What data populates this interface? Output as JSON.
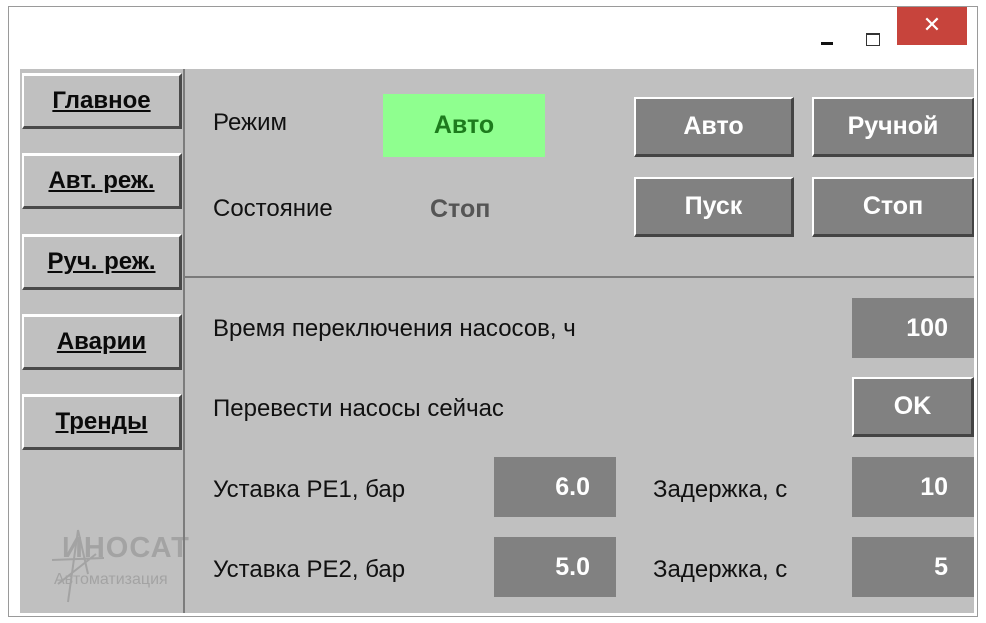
{
  "titlebar": {
    "minimize_icon": "minimize-icon",
    "maximize_icon": "maximize-icon",
    "close_glyph": "✕",
    "close_color": "#c7443c"
  },
  "nav": {
    "items": [
      {
        "label": "Главное"
      },
      {
        "label": "Авт. реж."
      },
      {
        "label": "Руч. реж."
      },
      {
        "label": "Аварии"
      },
      {
        "label": "Тренды"
      }
    ]
  },
  "logo": {
    "line1": "ИНОСАТ",
    "line2": "Автоматизация",
    "icon": "star-logo-icon"
  },
  "status": {
    "mode_label": "Режим",
    "mode_value": "Авто",
    "mode_color": "#8fff8f",
    "state_label": "Состояние",
    "state_value": "Стоп"
  },
  "controls": {
    "auto_button": "Авто",
    "manual_button": "Ручной",
    "start_button": "Пуск",
    "stop_button": "Стоп"
  },
  "settings": {
    "switch_time_label": "Время переключения насосов, ч",
    "switch_time_value": "100",
    "switch_now_label": "Перевести насосы сейчас",
    "ok_button": "OK",
    "pe1_label": "Уставка PE1, бар",
    "pe1_value": "6.0",
    "pe1_delay_label": "Задержка, с",
    "pe1_delay_value": "10",
    "pe2_label": "Уставка PE2, бар",
    "pe2_value": "5.0",
    "pe2_delay_label": "Задержка, с",
    "pe2_delay_value": "5"
  }
}
